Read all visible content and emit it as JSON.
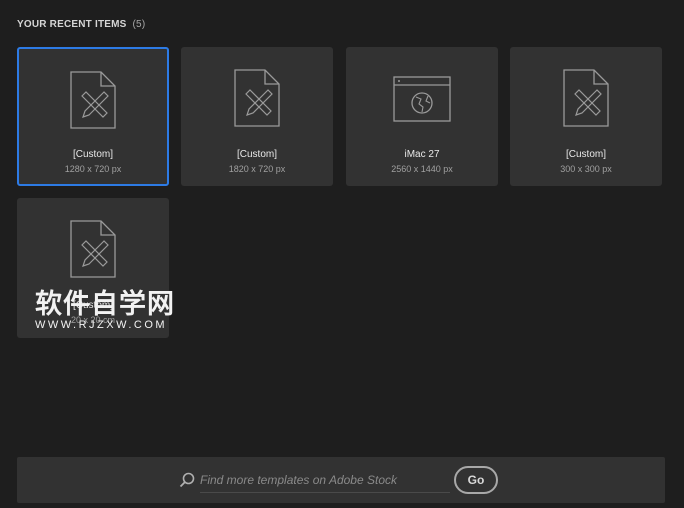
{
  "section": {
    "title": "YOUR RECENT ITEMS",
    "count": "(5)"
  },
  "items": [
    {
      "name": "[Custom]",
      "size": "1280 x 720 px",
      "icon": "document-pencil-ruler-icon"
    },
    {
      "name": "[Custom]",
      "size": "1820 x 720 px",
      "icon": "document-pencil-ruler-icon"
    },
    {
      "name": "iMac 27",
      "size": "2560 x 1440 px",
      "icon": "web-browser-globe-icon"
    },
    {
      "name": "[Custom]",
      "size": "300 x 300 px",
      "icon": "document-pencil-ruler-icon"
    },
    {
      "name": "[Custom]",
      "size": "20 x 20 cm",
      "icon": "document-pencil-ruler-icon"
    }
  ],
  "watermark": {
    "cn": "软件自学网",
    "en": "WWW.RJZXW.COM"
  },
  "search": {
    "placeholder": "Find more templates on Adobe Stock",
    "go_label": "Go"
  },
  "colors": {
    "accent": "#2d7be5",
    "card": "#323232",
    "background": "#1e1e1e"
  }
}
